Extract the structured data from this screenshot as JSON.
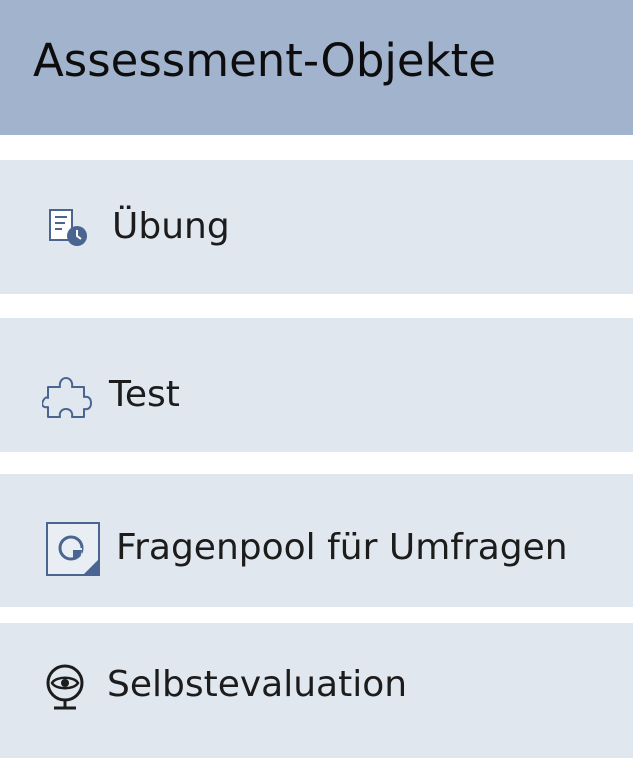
{
  "header": {
    "title": "Assessment-Objekte"
  },
  "items": [
    {
      "label": "Übung",
      "icon": "exercise-icon"
    },
    {
      "label": "Test",
      "icon": "puzzle-icon"
    },
    {
      "label": "Fragenpool für Umfragen",
      "icon": "survey-pool-icon"
    },
    {
      "label": "Selbstevaluation",
      "icon": "self-evaluation-icon"
    }
  ],
  "colors": {
    "header_background": "#a2b3cd",
    "item_background": "#e1e7ef",
    "icon_accent": "#4a6590"
  }
}
